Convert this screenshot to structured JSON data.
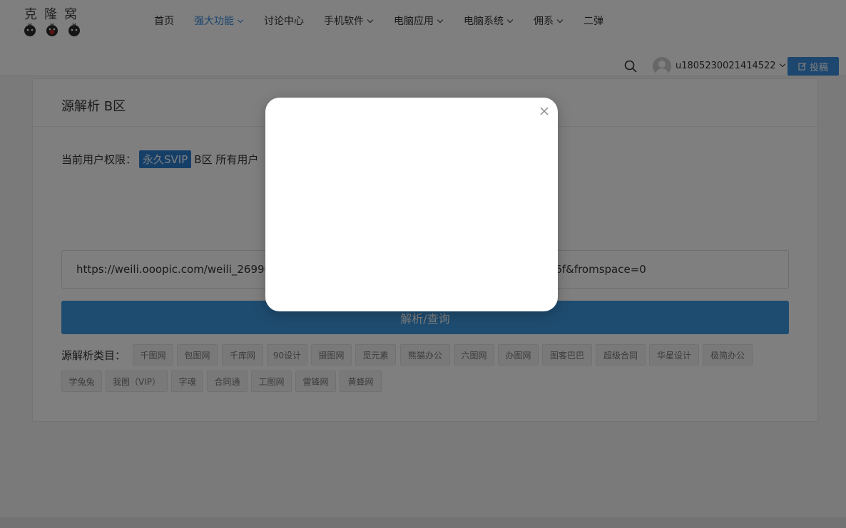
{
  "header": {
    "logo_text": "克隆窝",
    "nav": [
      {
        "label": "首页",
        "dropdown": false,
        "active": false
      },
      {
        "label": "强大功能",
        "dropdown": true,
        "active": true
      },
      {
        "label": "讨论中心",
        "dropdown": false,
        "active": false
      },
      {
        "label": "手机软件",
        "dropdown": true,
        "active": false
      },
      {
        "label": "电脑应用",
        "dropdown": true,
        "active": false
      },
      {
        "label": "电脑系统",
        "dropdown": true,
        "active": false
      },
      {
        "label": "佣系",
        "dropdown": true,
        "active": false
      },
      {
        "label": "二弹",
        "dropdown": false,
        "active": false
      }
    ],
    "username": "u1805230021414522",
    "post_label": "投稿",
    "accent_color": "#3388dd"
  },
  "card": {
    "title": "源解析 B区",
    "perm_label": "当前用户权限：",
    "perm_badge": "永久SVIP",
    "perm_note": "B区 所有用户",
    "url_value": "https://weili.ooopic.com/weili_269904                                              TrackD=66726f6d5f736f&fromspace=0",
    "parse_label": "解析/查询",
    "category_label": "源解析类目：",
    "categories_row1": [
      "千图网",
      "包图网",
      "千库网",
      "90设计",
      "摄图网",
      "觅元素",
      "熊猫办公",
      "六图网",
      "办图网",
      "图客巴巴",
      "超级合同",
      "华星设计",
      "极简办公"
    ],
    "categories_row2": [
      "学兔兔",
      "我图（VIP）",
      "字魂",
      "合同通",
      "工图网",
      "雷锋网",
      "黄蜂网"
    ]
  },
  "modal": {
    "visible": true
  },
  "icons": {
    "search": "search-icon",
    "close": "close-icon",
    "edit": "edit-icon",
    "chevron": "chevron-down-icon",
    "avatar": "user-avatar-icon"
  }
}
